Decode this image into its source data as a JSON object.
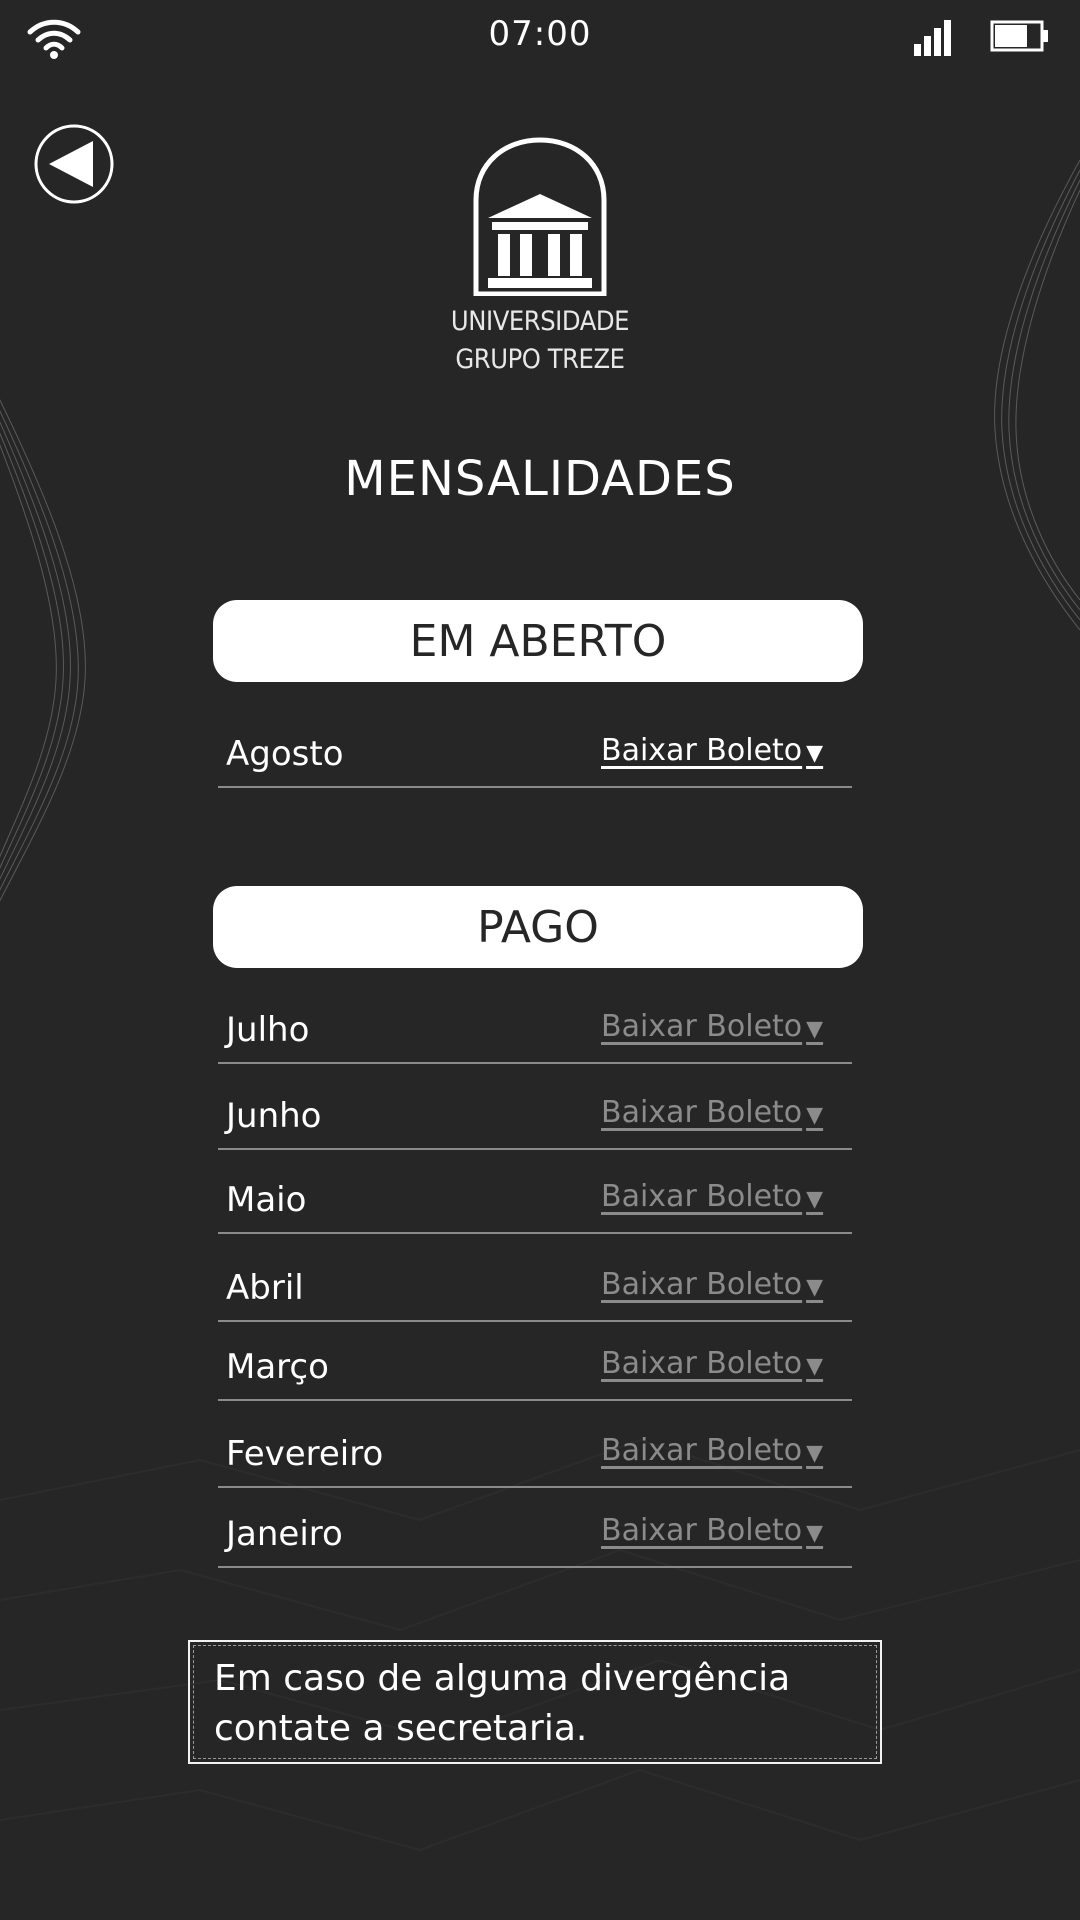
{
  "status_bar": {
    "time": "07:00",
    "wifi_icon": "wifi-icon",
    "signal_icon": "signal-icon",
    "battery_icon": "battery-icon"
  },
  "header": {
    "back_icon": "back-arrow-icon",
    "logo_icon": "university-building-icon",
    "logo_line1": "UNIVERSIDADE",
    "logo_line2": "GRUPO TREZE"
  },
  "page": {
    "title": "MENSALIDADES"
  },
  "sections": {
    "open": {
      "label": "EM ABERTO",
      "items": [
        {
          "month": "Agosto",
          "action": "Baixar Boleto",
          "arrow": "▼"
        }
      ]
    },
    "paid": {
      "label": "PAGO",
      "items": [
        {
          "month": "Julho",
          "action": "Baixar Boleto",
          "arrow": "▼"
        },
        {
          "month": "Junho",
          "action": "Baixar Boleto",
          "arrow": "▼"
        },
        {
          "month": "Maio",
          "action": "Baixar Boleto",
          "arrow": "▼"
        },
        {
          "month": "Abril",
          "action": "Baixar Boleto",
          "arrow": "▼"
        },
        {
          "month": "Março",
          "action": "Baixar Boleto",
          "arrow": "▼"
        },
        {
          "month": "Fevereiro",
          "action": "Baixar Boleto",
          "arrow": "▼"
        },
        {
          "month": "Janeiro",
          "action": "Baixar Boleto",
          "arrow": "▼"
        }
      ]
    }
  },
  "notice": {
    "text": "Em caso de alguma divergência contate a secretaria."
  },
  "colors": {
    "background": "#262626",
    "pill": "#ffffff",
    "active_link": "#ffffff",
    "muted_link": "#8b8b8b",
    "divider": "#8a8a8a"
  }
}
